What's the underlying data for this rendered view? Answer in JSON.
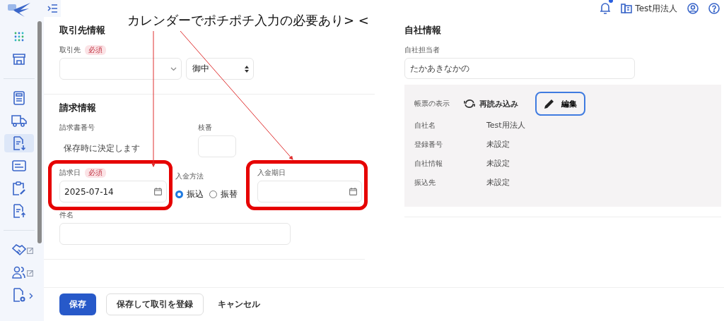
{
  "annotation": {
    "text": "カレンダーでポチポチ入力の必要あり> <"
  },
  "sidebar": {
    "items": [
      {
        "kind": "grid",
        "selected": false,
        "external": false,
        "submenu": false
      },
      {
        "kind": "store",
        "selected": false,
        "external": false,
        "submenu": false
      },
      {
        "kind": "divider"
      },
      {
        "kind": "calculator",
        "selected": false,
        "external": false,
        "submenu": false
      },
      {
        "kind": "truck",
        "selected": false,
        "external": false,
        "submenu": false
      },
      {
        "kind": "doc-down",
        "selected": true,
        "external": false,
        "submenu": false
      },
      {
        "kind": "card",
        "selected": false,
        "external": false,
        "submenu": false
      },
      {
        "kind": "clipboard",
        "selected": false,
        "external": false,
        "submenu": false
      },
      {
        "kind": "doc-up",
        "selected": false,
        "external": false,
        "submenu": false
      },
      {
        "kind": "divider"
      },
      {
        "kind": "handshake",
        "selected": false,
        "external": true,
        "submenu": false
      },
      {
        "kind": "people",
        "selected": false,
        "external": true,
        "submenu": false
      },
      {
        "kind": "doc-gear",
        "selected": false,
        "external": false,
        "submenu": true
      }
    ]
  },
  "header": {
    "notifications_unread": true,
    "company": "Test用法人"
  },
  "partner": {
    "title": "取引先情報",
    "label": "取引先",
    "required": "必須",
    "honorific": "御中"
  },
  "billing": {
    "title": "請求情報",
    "number_label": "請求書番号",
    "number_value": "保存時に決定します",
    "branch_label": "枝番",
    "date": {
      "label": "請求日",
      "required": "必須",
      "value": "2025-07-14",
      "highlighted": true
    },
    "method_label": "入金方法",
    "methods": [
      {
        "label": "振込",
        "selected": true
      },
      {
        "label": "振替",
        "selected": false
      }
    ],
    "due": {
      "label": "入金期日",
      "highlighted": true
    },
    "subject_label": "件名"
  },
  "company": {
    "title": "自社情報",
    "person_label": "自社担当者",
    "person_value": "たかあきなかの",
    "display_label": "帳票の表示",
    "reload": "再読み込み",
    "edit": "編集",
    "rows": [
      {
        "label": "自社名",
        "value": "Test用法人"
      },
      {
        "label": "登録番号",
        "value": "未設定"
      },
      {
        "label": "自社情報",
        "value": "未設定"
      },
      {
        "label": "振込先",
        "value": "未設定"
      }
    ]
  },
  "footer": {
    "buttons": [
      {
        "kind": "primary",
        "label": "保存"
      },
      {
        "kind": "outline",
        "label": "保存して取引を登録"
      },
      {
        "kind": "text",
        "label": "キャンセル"
      }
    ]
  }
}
